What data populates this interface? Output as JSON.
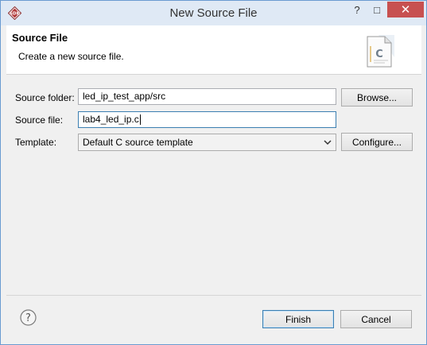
{
  "window": {
    "title": "New Source File",
    "app_icon_label": "SDK",
    "help_glyph": "?",
    "maximize_glyph": "□",
    "close_glyph": "✕"
  },
  "banner": {
    "title": "Source File",
    "description": "Create a new source file.",
    "file_icon_letter": "C"
  },
  "form": {
    "source_folder": {
      "label": "Source folder:",
      "value": "led_ip_test_app/src",
      "button": "Browse..."
    },
    "source_file": {
      "label": "Source file:",
      "value": "lab4_led_ip.c"
    },
    "template": {
      "label": "Template:",
      "value": "Default C source template",
      "button": "Configure..."
    }
  },
  "footer": {
    "help_glyph": "?",
    "finish": "Finish",
    "cancel": "Cancel"
  },
  "colors": {
    "titlebar": "#dfe9f5",
    "window_border": "#6a9bd1",
    "close_button": "#c75050",
    "focus_border": "#3c7fb1"
  }
}
